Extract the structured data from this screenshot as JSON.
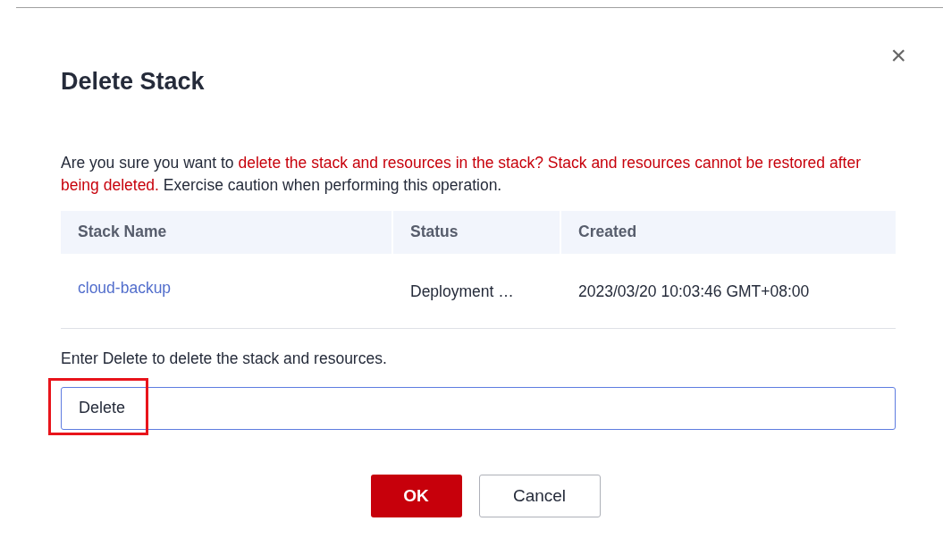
{
  "dialog": {
    "title": "Delete Stack",
    "close": "×"
  },
  "warning": [
    {
      "kind": "normal",
      "text": "Are you sure you want to "
    },
    {
      "kind": "danger",
      "text": "delete the stack and resources in the stack? Stack and resources cannot be restored after being deleted."
    },
    {
      "kind": "normal",
      "text": " Exercise caution when performing this operation."
    }
  ],
  "table": {
    "columns": [
      "Stack Name",
      "Status",
      "Created"
    ],
    "rows": [
      {
        "name": "cloud-backup",
        "status": "Deployment …",
        "created": "2023/03/20 10:03:46 GMT+08:00"
      }
    ]
  },
  "confirm": {
    "label": "Enter Delete to delete the stack and resources.",
    "value": "Delete",
    "highlighted": true
  },
  "buttons": [
    {
      "kind": "primary",
      "label": "OK"
    },
    {
      "kind": "secondary",
      "label": "Cancel"
    }
  ]
}
